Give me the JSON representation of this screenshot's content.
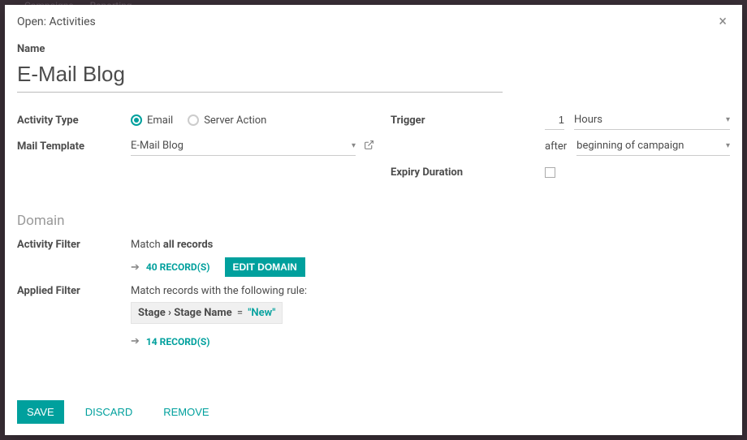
{
  "backdrop_nav": {
    "campaigns": "Campaigns",
    "reporting": "Reporting"
  },
  "modal": {
    "title": "Open: Activities",
    "name_label": "Name",
    "name_value": "E-Mail Blog",
    "activity_type": {
      "label": "Activity Type",
      "options": {
        "email": "Email",
        "server_action": "Server Action"
      },
      "selected": "email"
    },
    "mail_template": {
      "label": "Mail Template",
      "value": "E-Mail Blog"
    },
    "trigger": {
      "label": "Trigger",
      "interval_value": "1",
      "interval_unit": "Hours",
      "after_text": "after",
      "after_value": "beginning of campaign"
    },
    "expiry": {
      "label": "Expiry Duration",
      "checked": false
    },
    "domain": {
      "title": "Domain",
      "activity_filter": {
        "label": "Activity Filter",
        "match_text_prefix": "Match ",
        "match_text_bold": "all records",
        "record_count": "40 RECORD(S)",
        "edit_domain": "EDIT DOMAIN"
      },
      "applied_filter": {
        "label": "Applied Filter",
        "description": "Match records with the following rule:",
        "rule_path": "Stage › Stage Name",
        "rule_op": "=",
        "rule_value": "\"New\"",
        "record_count": "14 RECORD(S)"
      }
    },
    "footer": {
      "save": "SAVE",
      "discard": "DISCARD",
      "remove": "REMOVE"
    }
  }
}
